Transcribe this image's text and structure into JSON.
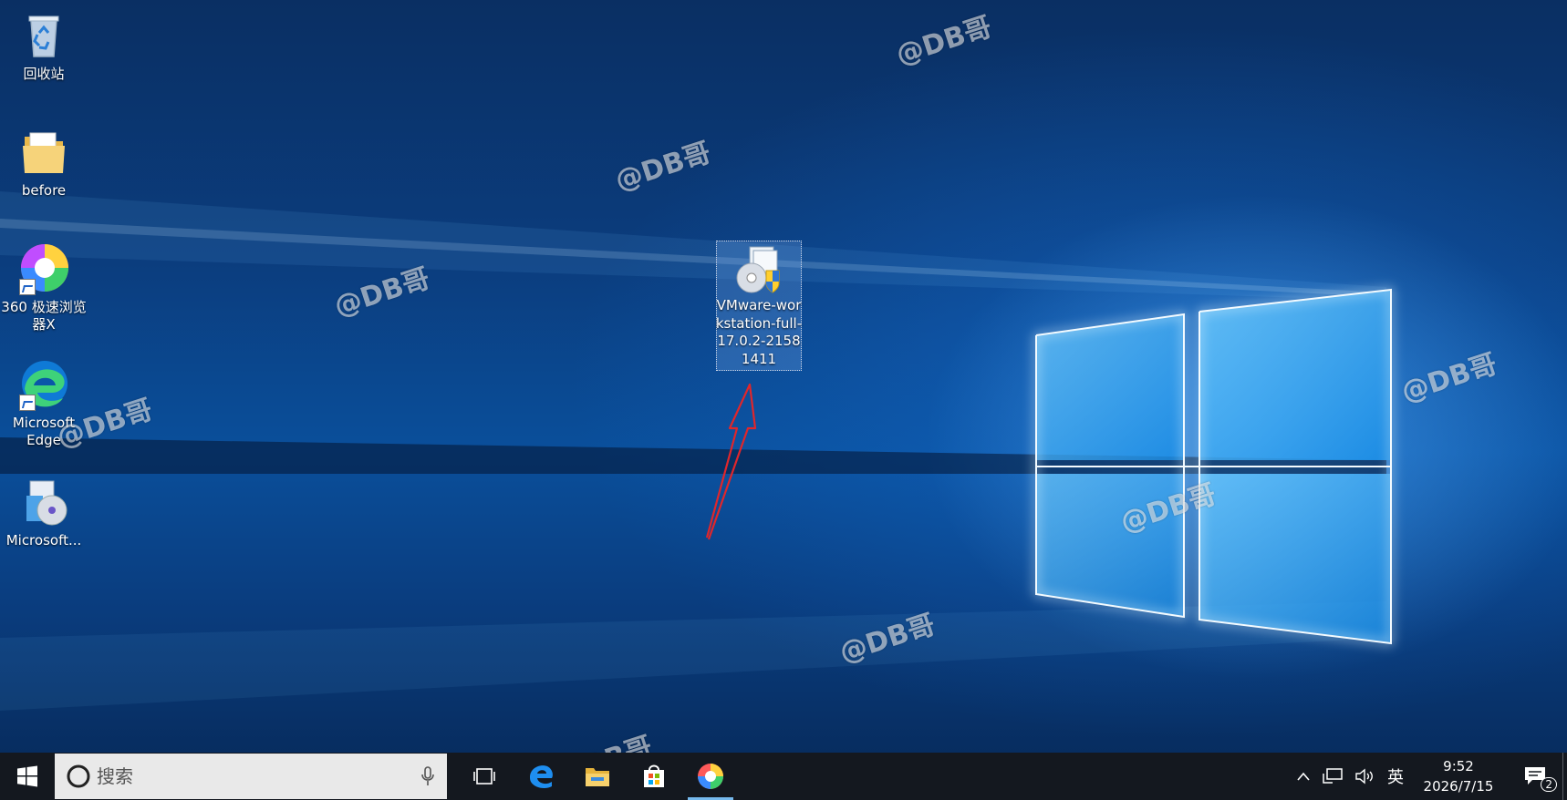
{
  "desktop": {
    "icons": [
      {
        "label": "回收站",
        "icon": "recycle-bin-icon"
      },
      {
        "label": "before",
        "icon": "folder-icon"
      },
      {
        "label": "360 极速浏览器X",
        "icon": "browser-360-icon"
      },
      {
        "label": "Microsoft Edge",
        "icon": "edge-icon"
      },
      {
        "label": "Microsoft...",
        "icon": "installer-icon"
      }
    ],
    "selected_file": {
      "label_lines": [
        "VMware-wor",
        "kstation-full-",
        "17.0.2-2158",
        "1411"
      ],
      "icon": "installer-shield-icon"
    },
    "watermark": "@DB哥"
  },
  "taskbar": {
    "search_placeholder": "搜索",
    "pinned_apps": [
      "task-view-icon",
      "edge-icon",
      "file-explorer-icon",
      "store-icon",
      "browser-360-icon"
    ],
    "tray": {
      "input_method": "英",
      "time": "9:52",
      "date": "2026/7/15",
      "notification_count": "2"
    }
  },
  "colors": {
    "desktop_blue": "#0a3d7f",
    "taskbar": "#14181f",
    "annotation_arrow": "#e0262b",
    "active_indicator": "#76b9ed"
  }
}
